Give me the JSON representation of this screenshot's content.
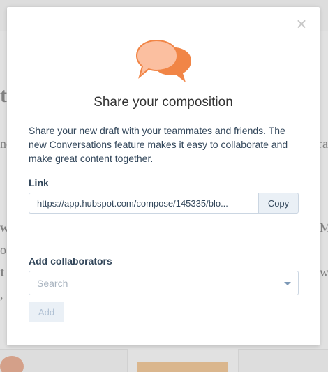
{
  "background": {
    "fragments": {
      "f1": "t",
      "f2": "nc",
      "f3": "ra",
      "f4": "w",
      "f5": "M",
      "f6": "o",
      "f7": "t",
      "f8": "w",
      "f9": ","
    }
  },
  "modal": {
    "close_label": "×",
    "title": "Share your composition",
    "description": "Share your new draft with your teammates and friends. The new Conversations feature makes it easy to collaborate and make great content together.",
    "link_label": "Link",
    "link_value": "https://app.hubspot.com/compose/145335/blo...",
    "copy_label": "Copy",
    "collaborators_label": "Add collaborators",
    "search_placeholder": "Search",
    "add_label": "Add",
    "icon": "conversation-bubbles-icon",
    "colors": {
      "bubble_back": "#f18546",
      "bubble_front": "#fbbfa0",
      "text_primary": "#33475b",
      "border": "#cbd6e2"
    }
  }
}
